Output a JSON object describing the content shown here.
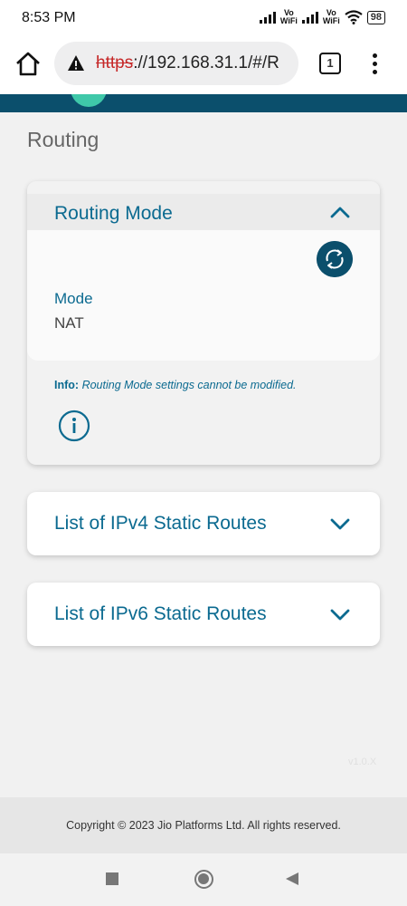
{
  "status": {
    "time": "8:53 PM",
    "vowifi_top": "Vo",
    "vowifi_bottom": "WiFi",
    "battery": "98"
  },
  "browser": {
    "url_scheme": "https",
    "url_rest": "://192.168.31.1/#/R",
    "tab_count": "1",
    "icons": [
      "home-icon",
      "warning-icon",
      "tabs-icon",
      "more-vert-icon"
    ]
  },
  "page": {
    "title": "Routing"
  },
  "routing_mode": {
    "title": "Routing Mode",
    "mode_label": "Mode",
    "mode_value": "NAT",
    "info_prefix": "Info:",
    "info_text": "Routing Mode settings cannot be modified."
  },
  "ipv4": {
    "title": "List of IPv4 Static Routes"
  },
  "ipv6": {
    "title": "List of IPv6 Static Routes"
  },
  "version": "v1.0.X",
  "footer": {
    "copyright": "Copyright © 2023 Jio Platforms Ltd. All rights reserved."
  },
  "colors": {
    "header": "#0b4f6c",
    "accent": "#0b6a90",
    "logo": "#3fc8a9"
  }
}
